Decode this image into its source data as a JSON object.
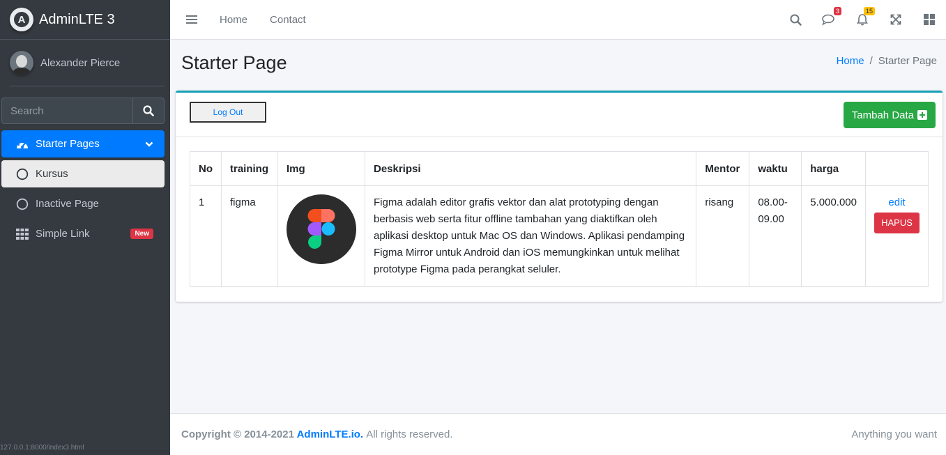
{
  "brand": {
    "name": "AdminLTE 3",
    "logo_letter": "A"
  },
  "user": {
    "name": "Alexander Pierce"
  },
  "sidebar_search": {
    "placeholder": "Search"
  },
  "nav": {
    "items": [
      {
        "label": "Starter Pages",
        "icon": "dashboard-gauge-icon"
      },
      {
        "label": "Kursus",
        "icon": "circle-outline-icon"
      },
      {
        "label": "Inactive Page",
        "icon": "circle-outline-icon"
      },
      {
        "label": "Simple Link",
        "icon": "grid-icon",
        "badge": "New"
      }
    ]
  },
  "status_url": "127.0.0.1:8000/index3.html",
  "topnav": {
    "links": [
      "Home",
      "Contact"
    ],
    "messages_count": "3",
    "notifications_count": "15"
  },
  "header": {
    "title": "Starter Page",
    "breadcrumb": {
      "home": "Home",
      "current": "Starter Page"
    }
  },
  "card": {
    "logout_label": "Log Out",
    "add_label": "Tambah Data"
  },
  "table": {
    "headers": [
      "No",
      "training",
      "Img",
      "Deskripsi",
      "Mentor",
      "waktu",
      "harga",
      ""
    ],
    "rows": [
      {
        "no": "1",
        "training": "figma",
        "img_icon": "figma-logo-icon",
        "deskripsi": "Figma adalah editor grafis vektor dan alat prototyping dengan berbasis web serta fitur offline tambahan yang diaktifkan oleh aplikasi desktop untuk Mac OS dan Windows. Aplikasi pendamping Figma Mirror untuk Android dan iOS memungkinkan untuk melihat prototype Figma pada perangkat seluler.",
        "mentor": "risang",
        "waktu": "08.00-09.00",
        "harga": "5.000.000",
        "edit_label": "edit",
        "delete_label": "HAPUS"
      }
    ]
  },
  "footer": {
    "copyright_prefix": "Copyright © 2014-2021",
    "brand_link": "AdminLTE.io.",
    "rights": "All rights reserved.",
    "right_text": "Anything you want"
  },
  "colors": {
    "sidebar_bg": "#343a40",
    "primary": "#007bff",
    "success": "#28a745",
    "danger": "#dc3545",
    "warning": "#ffc107",
    "info": "#17a2b8"
  }
}
